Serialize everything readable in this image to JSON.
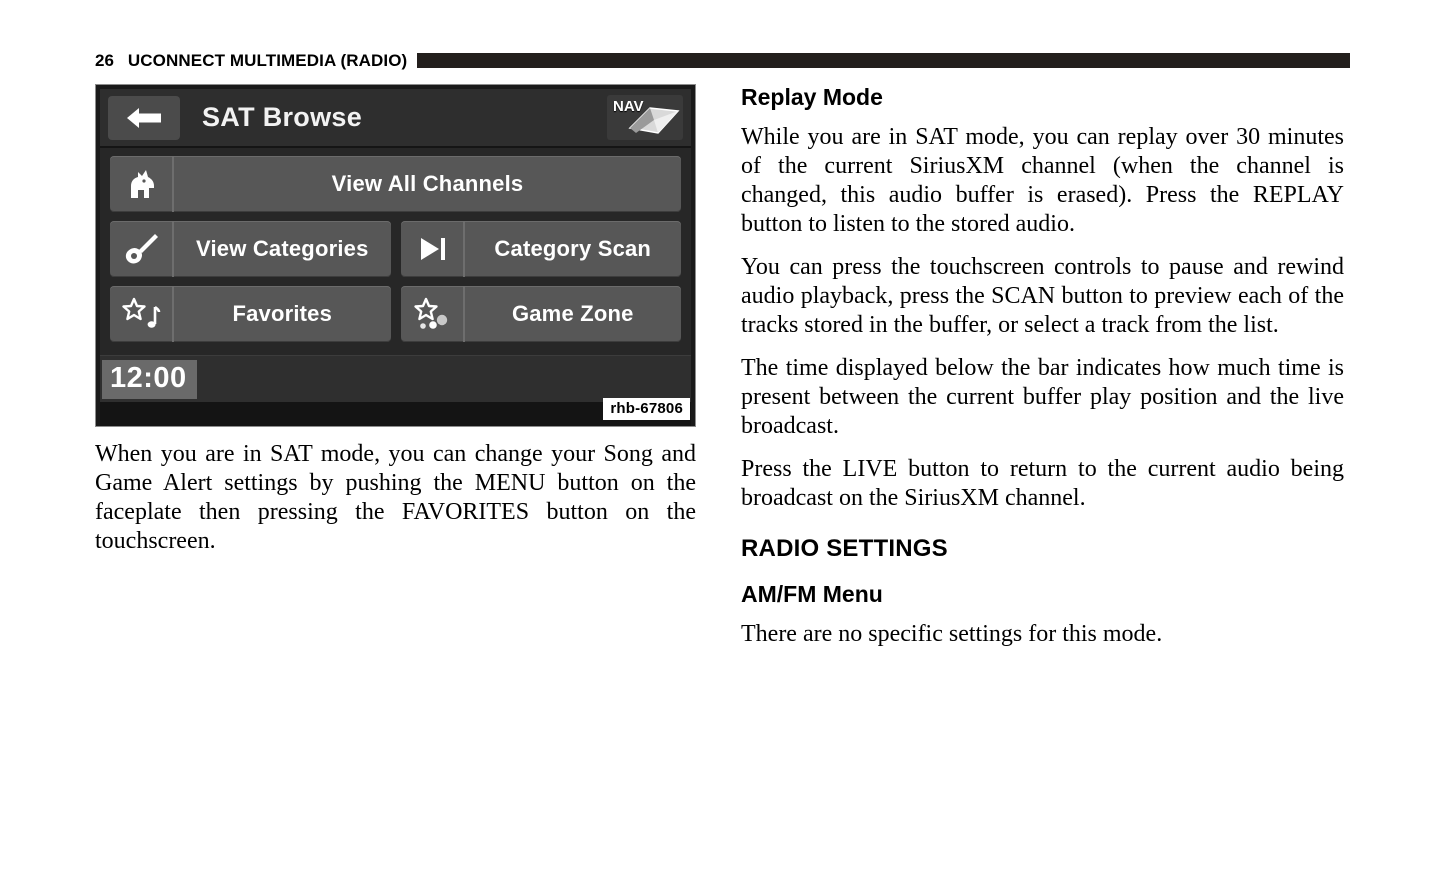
{
  "header": {
    "page_number": "26",
    "title": "UCONNECT MULTIMEDIA (RADIO)"
  },
  "figure": {
    "code": "rhb-67806",
    "screen": {
      "back_icon": "back-arrow-icon",
      "title": "SAT Browse",
      "nav_button": {
        "label": "NAV",
        "icon": "map-book-icon"
      },
      "tiles": [
        {
          "label": "View All Channels",
          "icon": "dog-icon"
        },
        {
          "label": "View Categories",
          "icon": "guitar-icon"
        },
        {
          "label": "Category Scan",
          "icon": "play-to-next-icon"
        },
        {
          "label": "Favorites",
          "icon": "star-music-note-icon"
        },
        {
          "label": "Game Zone",
          "icon": "star-balls-icon"
        }
      ],
      "clock": "12:00"
    }
  },
  "left_column": {
    "caption_paragraph": "When you are in SAT mode, you can change your Song and Game Alert settings by pushing the MENU button on the faceplate then pressing the FAVORITES button on the touchscreen."
  },
  "right_column": {
    "replay_heading": "Replay Mode",
    "replay_p1": "While you are in SAT mode, you can replay over 30 minutes of the current SiriusXM channel (when the channel is changed, this audio buffer is erased). Press the REPLAY button to listen to the stored audio.",
    "replay_p2": "You can press the touchscreen controls to pause and rewind audio playback, press the SCAN button to preview each of the tracks stored in the buffer, or select a track from the list.",
    "replay_p3": "The time displayed below the bar indicates how much time is present between the current buffer play position and the live broadcast.",
    "replay_p4": "Press the LIVE button to return to the current audio being broadcast on the SiriusXM channel.",
    "radio_settings_heading": "RADIO SETTINGS",
    "amfm_heading": "AM/FM Menu",
    "amfm_p1": "There are no specific settings for this mode."
  },
  "colors": {
    "rule": "#231f1d",
    "screen_background": "#2b2b2b",
    "tile": "#575757",
    "text": "#000000",
    "screen_text": "#ffffff"
  }
}
